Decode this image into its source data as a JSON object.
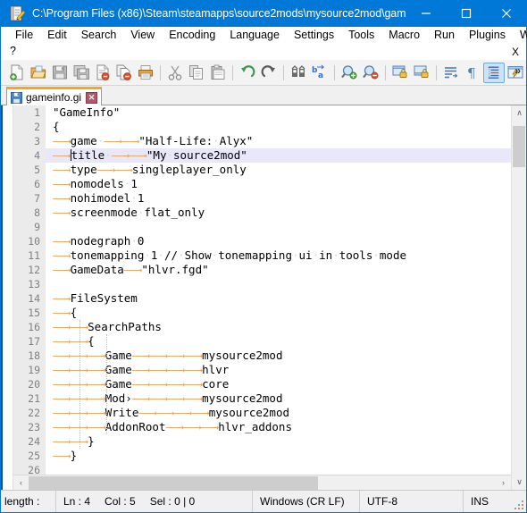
{
  "window": {
    "title": "C:\\Program Files (x86)\\Steam\\steamapps\\source2mods\\mysource2mod\\gam...",
    "app_icon": "notepad-pencil-icon",
    "minimize_label": "—",
    "maximize_label": "☐",
    "close_label": "✕",
    "accent_color": "#0078d7"
  },
  "menubar": {
    "items": [
      {
        "label": "File"
      },
      {
        "label": "Edit"
      },
      {
        "label": "Search"
      },
      {
        "label": "View"
      },
      {
        "label": "Encoding"
      },
      {
        "label": "Language"
      },
      {
        "label": "Settings"
      },
      {
        "label": "Tools"
      },
      {
        "label": "Macro"
      },
      {
        "label": "Run"
      },
      {
        "label": "Plugins"
      },
      {
        "label": "Window"
      }
    ],
    "overflow_item": "?",
    "close_document_label": "X"
  },
  "toolbar": {
    "buttons": [
      {
        "name": "new-file-icon"
      },
      {
        "name": "open-file-icon"
      },
      {
        "name": "save-icon"
      },
      {
        "name": "save-all-icon"
      },
      {
        "name": "close-file-icon"
      },
      {
        "name": "close-all-files-icon"
      },
      {
        "name": "print-icon"
      },
      {
        "name": "separator"
      },
      {
        "name": "cut-icon"
      },
      {
        "name": "copy-icon"
      },
      {
        "name": "paste-icon"
      },
      {
        "name": "separator"
      },
      {
        "name": "undo-icon"
      },
      {
        "name": "redo-icon"
      },
      {
        "name": "separator"
      },
      {
        "name": "find-icon"
      },
      {
        "name": "replace-icon"
      },
      {
        "name": "separator"
      },
      {
        "name": "zoom-in-icon"
      },
      {
        "name": "zoom-out-icon"
      },
      {
        "name": "separator"
      },
      {
        "name": "sync-vertical-scroll-icon"
      },
      {
        "name": "sync-horizontal-scroll-icon"
      },
      {
        "name": "separator"
      },
      {
        "name": "word-wrap-icon"
      },
      {
        "name": "show-all-characters-icon"
      },
      {
        "name": "show-indent-guide-icon"
      },
      {
        "name": "user-defined-dialog-icon"
      }
    ],
    "overflow_label": "»",
    "active_button": "show-indent-guide-icon"
  },
  "tabbar": {
    "tabs": [
      {
        "label": "gameinfo.gi",
        "icon": "saved-floppy-icon",
        "close_label": "✕",
        "active": true
      }
    ],
    "active_accent": "#f5a623"
  },
  "editor": {
    "caret_line": 4,
    "tab_arrow_color": "#e8a25c",
    "space_dot_color": "#d4d4d4",
    "current_line_bg": "#e8e8f8",
    "lines": [
      {
        "n": 1,
        "indent": 0,
        "content": "\"GameInfo\""
      },
      {
        "n": 2,
        "indent": 0,
        "content": "{"
      },
      {
        "n": 3,
        "indent": 1,
        "content": "game·→→\"Half-Life:·Alyx\""
      },
      {
        "n": 4,
        "indent": 1,
        "content": "title·→→\"My·source2mod\""
      },
      {
        "n": 5,
        "indent": 1,
        "content": "type→→singleplayer_only"
      },
      {
        "n": 6,
        "indent": 1,
        "content": "nomodels·1"
      },
      {
        "n": 7,
        "indent": 1,
        "content": "nohimodel·1"
      },
      {
        "n": 8,
        "indent": 1,
        "content": "screenmode·flat_only"
      },
      {
        "n": 9,
        "indent": 0,
        "content": ""
      },
      {
        "n": 10,
        "indent": 1,
        "content": "nodegraph·0"
      },
      {
        "n": 11,
        "indent": 1,
        "content": "tonemapping·1·//·Show·tonemapping·ui·in·tools·mode"
      },
      {
        "n": 12,
        "indent": 1,
        "content": "GameData→\"hlvr.fgd\""
      },
      {
        "n": 13,
        "indent": 0,
        "content": ""
      },
      {
        "n": 14,
        "indent": 1,
        "content": "FileSystem"
      },
      {
        "n": 15,
        "indent": 1,
        "content": "{"
      },
      {
        "n": 16,
        "indent": 2,
        "content": "SearchPaths"
      },
      {
        "n": 17,
        "indent": 2,
        "content": "{"
      },
      {
        "n": 18,
        "indent": 3,
        "content": "Game→→→→mysource2mod"
      },
      {
        "n": 19,
        "indent": 3,
        "content": "Game→→→→hlvr"
      },
      {
        "n": 20,
        "indent": 3,
        "content": "Game→→→→core"
      },
      {
        "n": 21,
        "indent": 3,
        "content": "Mod›→→→→mysource2mod"
      },
      {
        "n": 22,
        "indent": 3,
        "content": "Write→→→→mysource2mod"
      },
      {
        "n": 23,
        "indent": 3,
        "content": "AddonRoot→→→hlvr_addons"
      },
      {
        "n": 24,
        "indent": 2,
        "content": "}"
      },
      {
        "n": 25,
        "indent": 1,
        "content": "}"
      },
      {
        "n": 26,
        "indent": 0,
        "content": ""
      }
    ]
  },
  "scrollbars": {
    "vertical_up_arrow": "∧",
    "vertical_down_arrow": "∨",
    "horizontal_left_arrow": "‹",
    "horizontal_right_arrow": "›"
  },
  "statusbar": {
    "length": "length :",
    "ln": "Ln : 4",
    "col": "Col : 5",
    "sel": "Sel : 0 | 0",
    "eol": "Windows (CR LF)",
    "encoding": "UTF-8",
    "insert_mode": "INS"
  }
}
